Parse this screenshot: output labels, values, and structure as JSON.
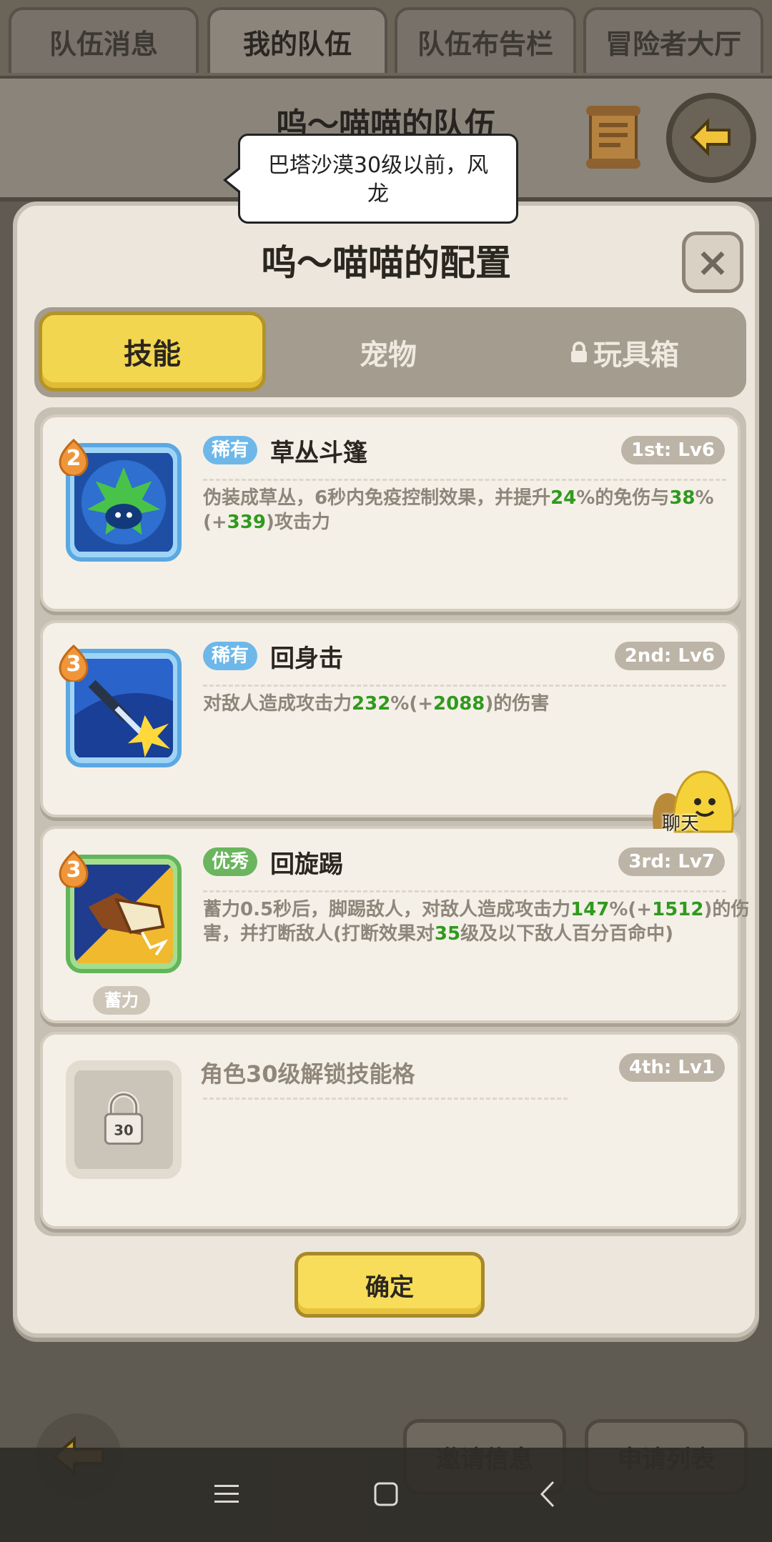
{
  "top_tabs": [
    "队伍消息",
    "我的队伍",
    "队伍布告栏",
    "冒险者大厅"
  ],
  "team": {
    "name": "呜～喵喵的队伍"
  },
  "tooltip": {
    "text": "巴塔沙漠30级以前，风龙"
  },
  "modal": {
    "title": "呜～喵喵的配置",
    "close_icon": "×",
    "tabs": [
      "技能",
      "宠物",
      "玩具箱"
    ],
    "confirm": "确定"
  },
  "skills": [
    {
      "badge": "2",
      "rarity": "稀有",
      "name": "草丛斗篷",
      "slot": "1st: Lv6",
      "desc": [
        "伪装成草丛，6秒内免疫控制效果，并提升",
        "24",
        "%的免伤与",
        "38",
        "%",
        "(+",
        "339",
        ")攻击力"
      ]
    },
    {
      "badge": "3",
      "rarity": "稀有",
      "name": "回身击",
      "slot": "2nd: Lv6",
      "desc": [
        "对敌人造成攻击力",
        "232",
        "%(+",
        "2088",
        ")的伤害"
      ]
    },
    {
      "badge": "3",
      "rarity": "优秀",
      "name": "回旋踢",
      "slot": "3rd: Lv7",
      "desc": [
        "蓄力0.5秒后，脚踢敌人，对敌人造成攻击力",
        "147",
        "%(+",
        "1512",
        ")的伤害，并打断敌人(打断效果对",
        "35",
        "级及以下敌人百分百命中)"
      ],
      "tag": "蓄力"
    },
    {
      "locked_title": "角色30级解锁技能格",
      "slot": "4th: Lv1",
      "lock_level": "30"
    }
  ],
  "chat": {
    "label": "聊天"
  },
  "bottom": {
    "invite": "邀请信息",
    "apply_list": "申请列表"
  },
  "colors": {
    "accent_yellow": "#f3d64f",
    "highlight_green": "#2f9a1e",
    "rare_blue": "#6db8e9",
    "good_green": "#6ab55d"
  }
}
